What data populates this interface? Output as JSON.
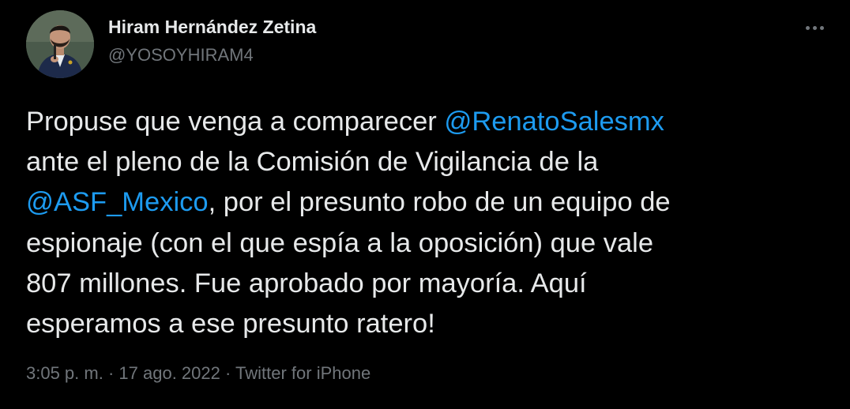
{
  "author": {
    "display_name": "Hiram Hernández Zetina",
    "handle": "@YOSOYHIRAM4"
  },
  "menu": {
    "icon": "more-horizontal-icon"
  },
  "tweet": {
    "lines": [
      {
        "before": "Propuse que venga a comparecer ",
        "mention": "@RenatoSalesmx",
        "after": ""
      },
      {
        "before": "ante el pleno de la Comisión de Vigilancia de la",
        "mention": "",
        "after": ""
      },
      {
        "before": "",
        "mention": "@ASF_Mexico",
        "after": ", por el presunto robo de un equipo de"
      },
      {
        "before": "espionaje (con el que espía a la oposición) que vale",
        "mention": "",
        "after": ""
      },
      {
        "before": "807 millones. Fue aprobado por mayoría. Aquí",
        "mention": "",
        "after": ""
      },
      {
        "before": "esperamos a ese presunto ratero!",
        "mention": "",
        "after": ""
      }
    ]
  },
  "meta": {
    "time": "3:05 p. m.",
    "date": "17 ago. 2022",
    "source": "Twitter for iPhone",
    "separator": " · "
  },
  "colors": {
    "background": "#000000",
    "text": "#e7e9ea",
    "secondary": "#71767b",
    "link": "#1d9bf0"
  }
}
